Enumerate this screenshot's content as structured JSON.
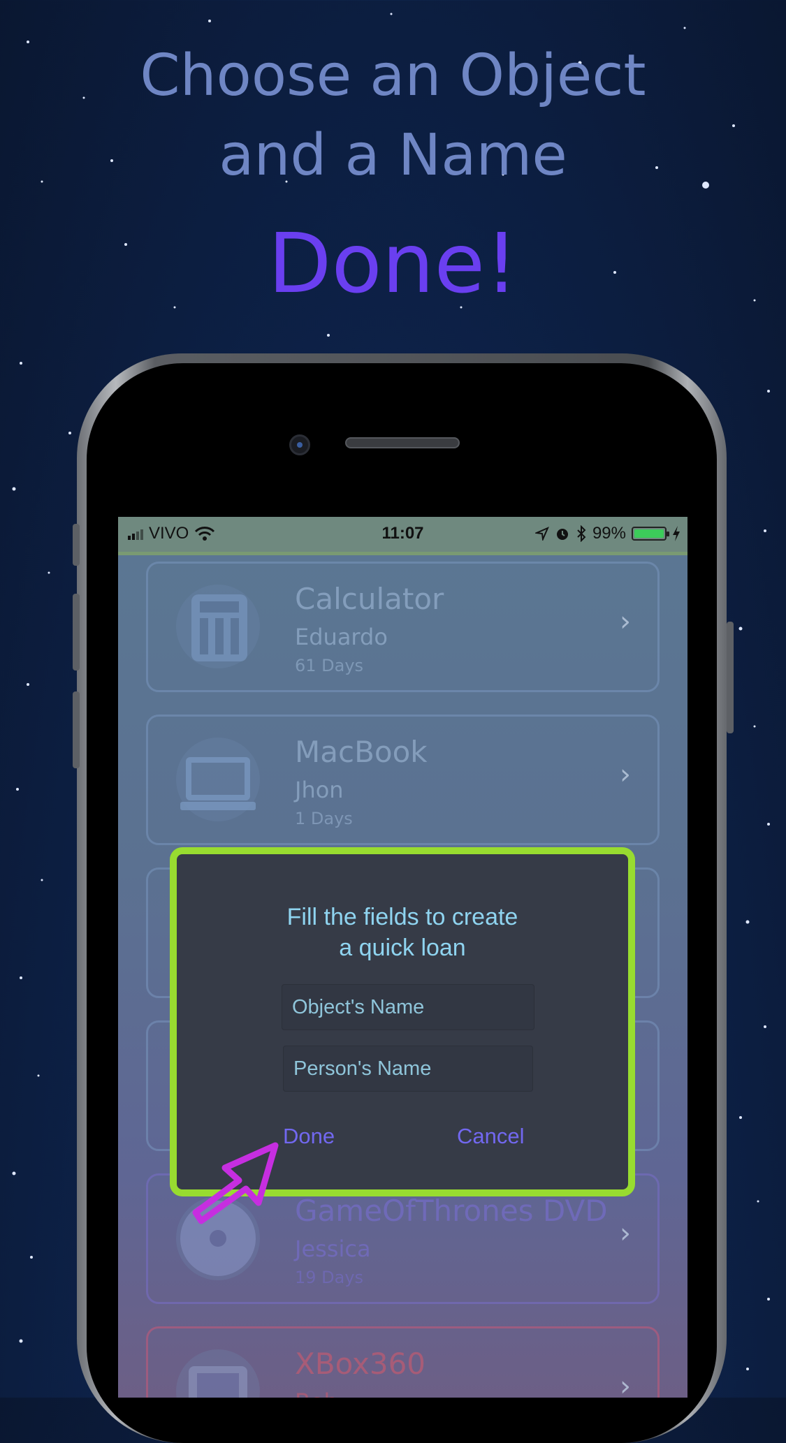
{
  "headline": {
    "line1": "Choose an Object",
    "line2": "and a Name",
    "emphasis": "Done!"
  },
  "status_bar": {
    "carrier": "VIVO",
    "time": "11:07",
    "battery": "99%"
  },
  "loans": [
    {
      "object": "Calculator",
      "person": "Eduardo",
      "days": "61 Days",
      "icon": "calculator-icon"
    },
    {
      "object": "MacBook",
      "person": "Jhon",
      "days": "1 Days",
      "icon": "laptop-icon"
    },
    {
      "object": "GameOfThrones DVD",
      "person": "Jessica",
      "days": "19 Days",
      "icon": "disc-icon"
    },
    {
      "object": "XBox360",
      "person": "Bob",
      "days": "",
      "icon": "console-icon"
    }
  ],
  "dialog": {
    "title_line1": "Fill the fields to create",
    "title_line2": "a quick loan",
    "object_placeholder": "Object's Name",
    "person_placeholder": "Person's Name",
    "done_label": "Done",
    "cancel_label": "Cancel"
  },
  "colors": {
    "headline": "#6f86c4",
    "emphasis": "#6a3ff0",
    "dialog_border": "#98dc30",
    "dialog_bg": "#363b47",
    "dialog_title": "#8fd4f0",
    "button": "#7268f0",
    "arrow": "#c62ee0"
  },
  "chevron": "›"
}
